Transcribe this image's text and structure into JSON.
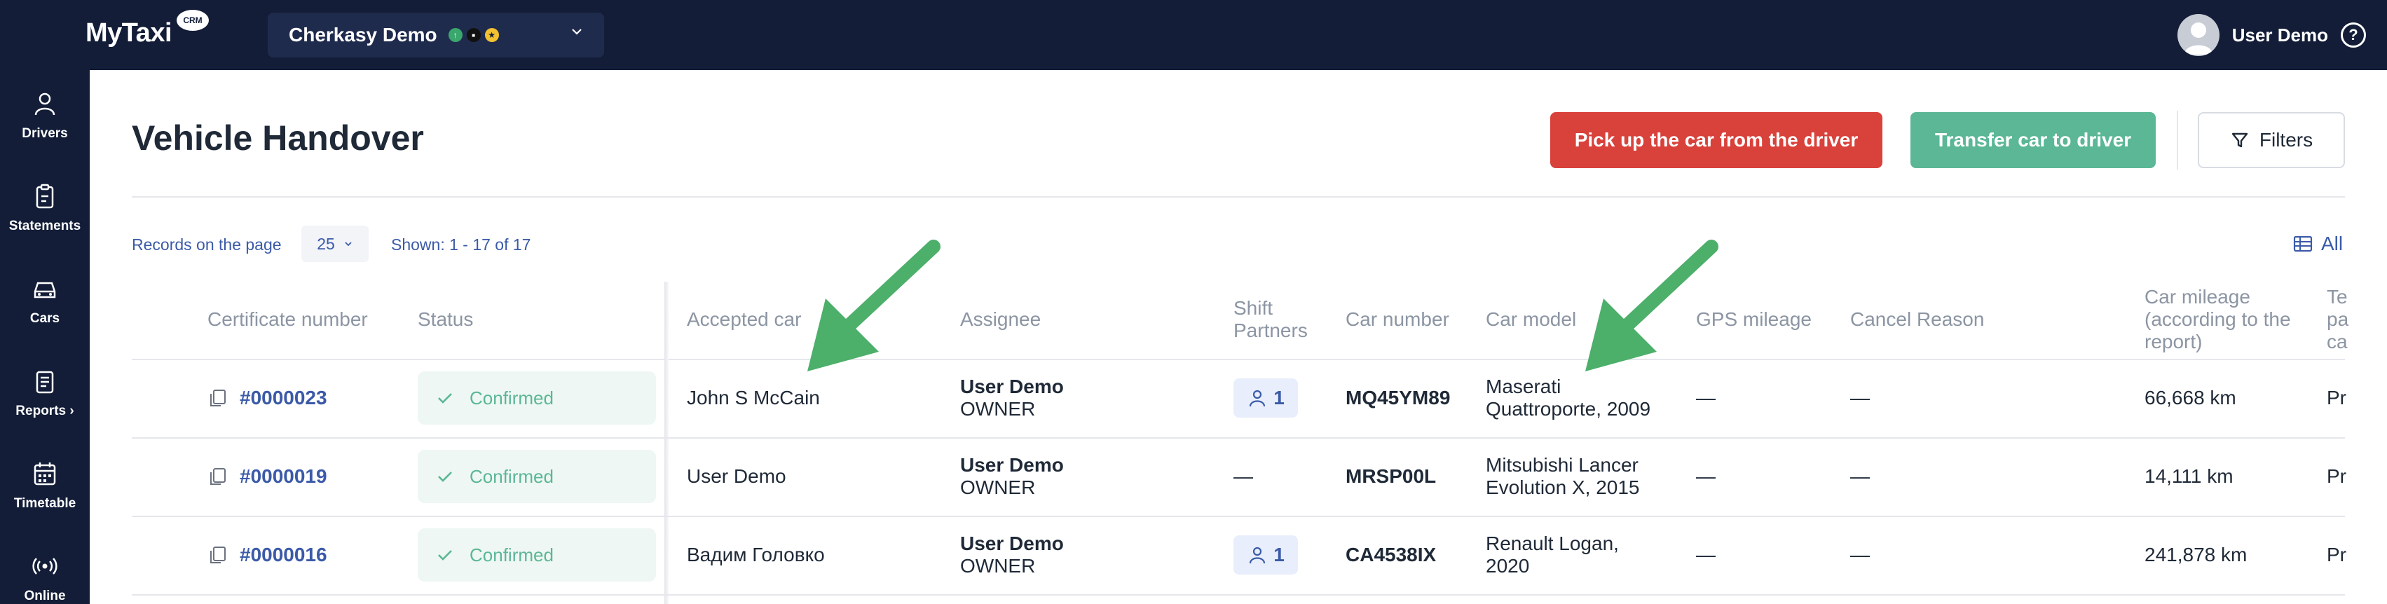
{
  "app": {
    "logo": "MyTaxi",
    "logo_badge": "CRM",
    "company": "Cherkasy Demo",
    "company_badges": [
      {
        "icon": "circle-check-icon",
        "color": "#3aa76d"
      },
      {
        "icon": "taxi-logo-icon",
        "color": "#111111"
      },
      {
        "icon": "coin-icon",
        "color": "#f2c230"
      }
    ],
    "user_name": "User Demo"
  },
  "sidebar": {
    "items": [
      {
        "label": "Drivers",
        "icon": "user-icon"
      },
      {
        "label": "Statements",
        "icon": "clipboard-icon"
      },
      {
        "label": "Cars",
        "icon": "car-icon"
      },
      {
        "label": "Reports ›",
        "icon": "report-icon"
      },
      {
        "label": "Timetable",
        "icon": "calendar-icon"
      },
      {
        "label": "Online",
        "icon": "broadcast-icon"
      }
    ]
  },
  "page": {
    "title": "Vehicle Handover",
    "pickup_label": "Pick up the car from the driver",
    "transfer_label": "Transfer car to driver",
    "filters_label": "Filters",
    "records_label": "Records on the page",
    "records_value": "25",
    "shown_label": "Shown: 1 - 17 of 17",
    "columns_label": "All"
  },
  "table": {
    "headers": {
      "certificate": "Certificate number",
      "status": "Status",
      "accepted_car": "Accepted car",
      "assignee": "Assignee",
      "shift_line1": "Shift",
      "shift_line2": "Partners",
      "car_number": "Car number",
      "car_model": "Car model",
      "gps": "GPS mileage",
      "cancel": "Cancel Reason",
      "mileage_line1": "Car mileage",
      "mileage_line2": "(according to the",
      "mileage_line3": "report)",
      "extra_line1": "Te",
      "extra_line2": "pa",
      "extra_line3": "ca"
    },
    "rows": [
      {
        "certificate": "#0000023",
        "status": "Confirmed",
        "accepted_car": "John S McCain",
        "assignee_name": "User Demo",
        "assignee_role": "OWNER",
        "shift_partners": "1",
        "car_number": "MQ45YM89",
        "car_model_line1": "Maserati",
        "car_model_line2": "Quattroporte, 2009",
        "gps": "—",
        "cancel": "—",
        "mileage": "66,668 km",
        "extra": "Pr"
      },
      {
        "certificate": "#0000019",
        "status": "Confirmed",
        "accepted_car": "User Demo",
        "assignee_name": "User Demo",
        "assignee_role": "OWNER",
        "shift_partners": "—",
        "car_number": "MRSP00L",
        "car_model_line1": "Mitsubishi Lancer",
        "car_model_line2": "Evolution X, 2015",
        "gps": "—",
        "cancel": "—",
        "mileage": "14,111 km",
        "extra": "Pr"
      },
      {
        "certificate": "#0000016",
        "status": "Confirmed",
        "accepted_car": "Вадим Головко",
        "assignee_name": "User Demo",
        "assignee_role": "OWNER",
        "shift_partners": "1",
        "car_number": "CA4538IX",
        "car_model_line1": "Renault Logan,",
        "car_model_line2": "2020",
        "gps": "—",
        "cancel": "—",
        "mileage": "241,878 km",
        "extra": "Pr"
      }
    ]
  },
  "colors": {
    "nav_bg": "#131d38",
    "accent": "#3b5aa8",
    "danger": "#d9413b",
    "success": "#5bb795",
    "annotation_arrow": "#4caf6a"
  }
}
